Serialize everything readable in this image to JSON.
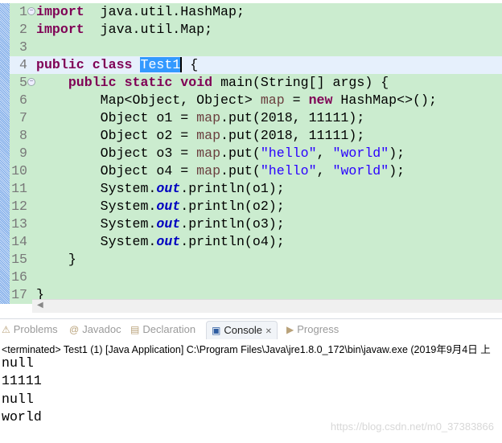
{
  "editor": {
    "lines": [
      {
        "n": "1",
        "fold": true,
        "t": [
          [
            "kw",
            "import"
          ],
          [
            "",
            "  java.util.HashMap;"
          ]
        ]
      },
      {
        "n": "2",
        "t": [
          [
            "kw",
            "import"
          ],
          [
            "",
            "  java.util.Map;"
          ]
        ]
      },
      {
        "n": "3",
        "t": []
      },
      {
        "n": "4",
        "current": true,
        "t": [
          [
            "kw",
            "public"
          ],
          [
            "",
            " "
          ],
          [
            "kw",
            "class"
          ],
          [
            "",
            " "
          ],
          [
            "sel",
            "Test1"
          ],
          [
            "",
            " {"
          ]
        ]
      },
      {
        "n": "5",
        "fold": true,
        "t": [
          [
            "",
            "    "
          ],
          [
            "kw",
            "public"
          ],
          [
            "",
            " "
          ],
          [
            "kw",
            "static"
          ],
          [
            "",
            " "
          ],
          [
            "kw",
            "void"
          ],
          [
            "",
            " main(String[] args) {"
          ]
        ]
      },
      {
        "n": "6",
        "t": [
          [
            "",
            "        Map<Object, Object> "
          ],
          [
            "var",
            "map"
          ],
          [
            "",
            " = "
          ],
          [
            "kw",
            "new"
          ],
          [
            "",
            " HashMap<>();"
          ]
        ]
      },
      {
        "n": "7",
        "t": [
          [
            "",
            "        Object o1 = "
          ],
          [
            "var",
            "map"
          ],
          [
            "",
            ".put(2018, 11111);"
          ]
        ]
      },
      {
        "n": "8",
        "t": [
          [
            "",
            "        Object o2 = "
          ],
          [
            "var",
            "map"
          ],
          [
            "",
            ".put(2018, 11111);"
          ]
        ]
      },
      {
        "n": "9",
        "t": [
          [
            "",
            "        Object o3 = "
          ],
          [
            "var",
            "map"
          ],
          [
            "",
            ".put("
          ],
          [
            "str",
            "\"hello\""
          ],
          [
            "",
            ", "
          ],
          [
            "str",
            "\"world\""
          ],
          [
            "",
            ");"
          ]
        ]
      },
      {
        "n": "10",
        "t": [
          [
            "",
            "        Object o4 = "
          ],
          [
            "var",
            "map"
          ],
          [
            "",
            ".put("
          ],
          [
            "str",
            "\"hello\""
          ],
          [
            "",
            ", "
          ],
          [
            "str",
            "\"world\""
          ],
          [
            "",
            ");"
          ]
        ]
      },
      {
        "n": "11",
        "t": [
          [
            "",
            "        System."
          ],
          [
            "fld",
            "out"
          ],
          [
            "",
            ".println(o1);"
          ]
        ]
      },
      {
        "n": "12",
        "t": [
          [
            "",
            "        System."
          ],
          [
            "fld",
            "out"
          ],
          [
            "",
            ".println(o2);"
          ]
        ]
      },
      {
        "n": "13",
        "t": [
          [
            "",
            "        System."
          ],
          [
            "fld",
            "out"
          ],
          [
            "",
            ".println(o3);"
          ]
        ]
      },
      {
        "n": "14",
        "t": [
          [
            "",
            "        System."
          ],
          [
            "fld",
            "out"
          ],
          [
            "",
            ".println(o4);"
          ]
        ]
      },
      {
        "n": "15",
        "t": [
          [
            "",
            "    }"
          ]
        ]
      },
      {
        "n": "16",
        "t": []
      },
      {
        "n": "17",
        "t": [
          [
            "",
            "}"
          ]
        ]
      }
    ]
  },
  "tabs": [
    {
      "label": "Problems",
      "icon": "problems-icon",
      "glyph": "⚠"
    },
    {
      "label": "Javadoc",
      "icon": "at-icon",
      "glyph": "@"
    },
    {
      "label": "Declaration",
      "icon": "declaration-icon",
      "glyph": "▤"
    },
    {
      "label": "Console",
      "icon": "console-icon",
      "glyph": "▣",
      "active": true,
      "close": "✕"
    },
    {
      "label": "Progress",
      "icon": "progress-icon",
      "glyph": "▶"
    }
  ],
  "console": {
    "status": "<terminated> Test1 (1) [Java Application] C:\\Program Files\\Java\\jre1.8.0_172\\bin\\javaw.exe (2019年9月4日 上",
    "output": [
      "null",
      "11111",
      "null",
      "world"
    ]
  },
  "watermark": "https://blog.csdn.net/m0_37383866"
}
